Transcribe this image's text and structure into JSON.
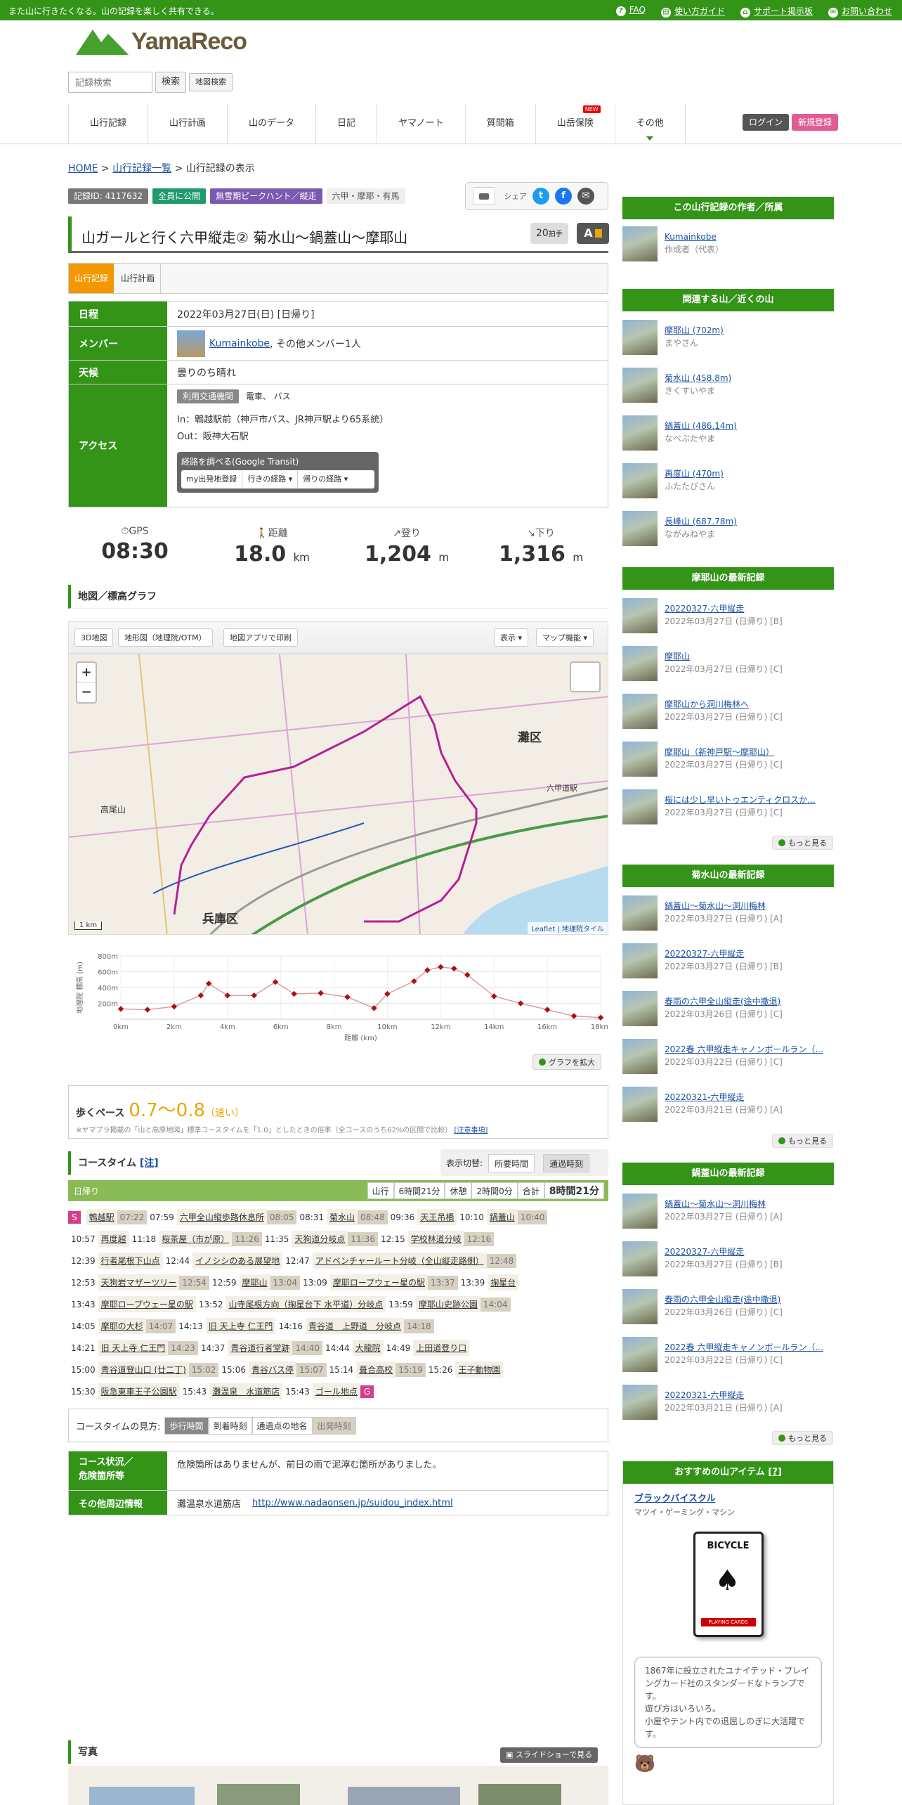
{
  "topbar": {
    "message": "また山に行きたくなる。山の記録を楽しく共有できる。",
    "links": [
      "FAQ",
      "使い方ガイド",
      "サポート掲示板",
      "お問い合わせ"
    ]
  },
  "logo": {
    "text": "YamaReco"
  },
  "search": {
    "placeholder": "記録検索",
    "button": "検索",
    "map_button": "地図検索"
  },
  "nav": [
    "山行記録",
    "山行計画",
    "山のデータ",
    "日記",
    "ヤマノート",
    "質問箱",
    "山岳保険",
    "その他"
  ],
  "nav_new": "NEW",
  "login": {
    "login": "ログイン",
    "register": "新規登録"
  },
  "breadcrumb": {
    "home": "HOME",
    "list": "山行記録一覧",
    "current": " > 山行記録の表示"
  },
  "tags": [
    "記録ID: 4117632",
    "全員に公開",
    "無雪期ピークハント／縦走",
    "六甲・摩耶・有馬"
  ],
  "share_label": "シェア",
  "title": "山ガールと行く六甲縦走② 菊水山〜鍋蓋山〜摩耶山",
  "clap": {
    "count": "20",
    "unit": "拍手"
  },
  "ai_label": "A",
  "tabs": [
    "山行記録",
    "山行計画"
  ],
  "info": {
    "date_k": "日程",
    "date_v": "2022年03月27日(日) [日帰り]",
    "member_k": "メンバー",
    "member_link": "Kumainkobe",
    "member_rest": ", その他メンバー1人",
    "weather_k": "天候",
    "weather_v": "曇りのち晴れ",
    "access_k": "アクセス",
    "access_badge": "利用交通機関",
    "access_modes": "電車、 バス",
    "access_in": "In：鵯越駅前（神戸市バス、JR神戸駅より65系統）",
    "access_out": "Out：阪神大石駅",
    "transit_title": "経路を調べる(Google Transit)",
    "transit_buttons": [
      "my出発地登録",
      "行きの経路",
      "帰りの経路"
    ]
  },
  "stats": [
    {
      "label": "GPS",
      "value": "08:30",
      "unit": ""
    },
    {
      "label": "距離",
      "value": "18.0",
      "unit": "km"
    },
    {
      "label": "登り",
      "value": "1,204",
      "unit": "m"
    },
    {
      "label": "下り",
      "value": "1,316",
      "unit": "m"
    }
  ],
  "map_section": "地図／標高グラフ",
  "map_tools": [
    "3D地図",
    "地形図（地理院/OTM）",
    "地図アプリで印刷",
    "表示",
    "マップ機能"
  ],
  "map_labels": {
    "mt": "灘区",
    "hyogo": "兵庫区",
    "takao": "高尾山",
    "scale": "1 km",
    "attrib": "Leaflet | 地理院タイル",
    "station": "六甲道駅"
  },
  "graph": {
    "ylabel": "地理院 標高 (m)",
    "xlabel": "距離 (km)"
  },
  "chart_data": {
    "type": "line",
    "title": "",
    "xlabel": "距離 (km)",
    "ylabel": "地理院 標高 (m)",
    "x_ticks": [
      "0km",
      "2km",
      "4km",
      "6km",
      "8km",
      "10km",
      "12km",
      "14km",
      "16km",
      "18km"
    ],
    "y_ticks": [
      "800m",
      "600m",
      "400m",
      "200m"
    ],
    "xlim": [
      0,
      18
    ],
    "ylim": [
      0,
      800
    ],
    "x": [
      0,
      1,
      2,
      3,
      3.3,
      4,
      5,
      5.8,
      6.5,
      7.5,
      8.5,
      9.5,
      10,
      11,
      11.5,
      12,
      12.5,
      13,
      14,
      15,
      16,
      17,
      18
    ],
    "y": [
      130,
      120,
      160,
      300,
      450,
      300,
      300,
      470,
      320,
      330,
      280,
      140,
      320,
      480,
      620,
      660,
      640,
      560,
      290,
      200,
      120,
      40,
      20
    ]
  },
  "graph_expand": "グラフを拡大",
  "pace": {
    "label": "歩くペース",
    "value": "0.7～0.8",
    "speed": "（速い）",
    "note": "※ヤマプラ掲載の「山と高原地図」標準コースタイムを「1.0」としたときの倍率（全コースのうち62%の区間で比較）",
    "note_link": "[注意事項]"
  },
  "coursetime": {
    "title": "コースタイム",
    "note": "[注]",
    "switch_label": "表示切替:",
    "switch": [
      "所要時間",
      "通過時刻"
    ],
    "day": "日帰り",
    "summary": [
      "山行",
      "6時間21分",
      "休憩",
      "2時間0分",
      "合計",
      "8時間21分"
    ]
  },
  "course_rows": [
    [
      [
        "S"
      ],
      [
        "",
        "鵯越駅",
        "07:22"
      ],
      [
        "07:59",
        "六甲全山縦歩路休息所",
        "08:05"
      ],
      [
        "08:31",
        "菊水山",
        "08:48"
      ],
      [
        "09:36",
        "天王吊橋",
        ""
      ],
      [
        "10:10",
        "鍋蓋山",
        "10:40"
      ]
    ],
    [
      [
        "10:57",
        "再度越",
        ""
      ],
      [
        "11:18",
        "桜茶屋（市が原）",
        "11:26"
      ],
      [
        "11:35",
        "天狗道分岐点",
        "11:36"
      ],
      [
        "12:15",
        "学校林道分岐",
        "12:16"
      ]
    ],
    [
      [
        "12:39",
        "行者尾根下山点",
        ""
      ],
      [
        "12:44",
        "イノシシのある展望地",
        ""
      ],
      [
        "12:47",
        "アドベンチャールート分岐（全山縦走路側）",
        "12:48"
      ]
    ],
    [
      [
        "12:53",
        "天狗岩マザーツリー",
        "12:54"
      ],
      [
        "12:59",
        "摩耶山",
        "13:04"
      ],
      [
        "13:09",
        "摩耶ロープウェー星の駅",
        "13:37"
      ],
      [
        "13:39",
        "掬星台",
        ""
      ]
    ],
    [
      [
        "13:43",
        "摩耶ロープウェー星の駅",
        ""
      ],
      [
        "13:52",
        "山寺尾根方向（掬星台下 水平道）分岐点",
        ""
      ],
      [
        "13:59",
        "摩耶山史跡公園",
        "14:04"
      ]
    ],
    [
      [
        "14:05",
        "摩耶の大杉",
        "14:07"
      ],
      [
        "14:13",
        "旧 天上寺 仁王門",
        ""
      ],
      [
        "14:16",
        "青谷道　上野道　分岐点",
        "14:18"
      ]
    ],
    [
      [
        "14:21",
        "旧 天上寺 仁王門",
        "14:23"
      ],
      [
        "14:37",
        "青谷道行者堂跡",
        "14:40"
      ],
      [
        "14:44",
        "大龍院",
        ""
      ],
      [
        "14:49",
        "上田道登り口",
        ""
      ]
    ],
    [
      [
        "15:00",
        "青谷道登山口 (廿二丁)",
        "15:02"
      ],
      [
        "15:06",
        "青谷バス停",
        "15:07"
      ],
      [
        "15:14",
        "葺合高校",
        "15:19"
      ],
      [
        "15:26",
        "王子動物園",
        ""
      ]
    ],
    [
      [
        "15:30",
        "阪急東車王子公園駅",
        ""
      ],
      [
        "15:43",
        "灘温泉　水道筋店",
        ""
      ],
      [
        "15:43",
        "ゴール地点"
      ],
      [
        "G"
      ]
    ]
  ],
  "viewhow": {
    "label": "コースタイムの見方:",
    "items": [
      "歩行時間",
      "到着時刻",
      "通過点の地名",
      "出発時刻"
    ]
  },
  "cond": {
    "k1a": "コース状況／",
    "k1b": "危険箇所等",
    "v1": "危険箇所はありませんが、前日の雨で泥濘む箇所がありました。",
    "k2": "その他周辺情報",
    "v2a": "灘温泉水道筋店",
    "v2b": "http://www.nadaonsen.jp/suidou_index.html"
  },
  "photos_section": "写真",
  "slideshow": "スライドショーで見る",
  "side": {
    "author_hd": "この山行記録の作者／所属",
    "author_name": "Kumainkobe",
    "author_role": "作成者（代表）",
    "related_hd": "関連する山／近くの山",
    "related": [
      [
        "摩耶山 (702m)",
        "まやさん"
      ],
      [
        "菊水山 (458.8m)",
        "きくすいやま"
      ],
      [
        "鍋蓋山 (486.14m)",
        "なべぶたやま"
      ],
      [
        "再度山 (470m)",
        "ふたたびさん"
      ],
      [
        "長峰山 (687.78m)",
        "ながみねやま"
      ]
    ],
    "maya_hd": "摩耶山の最新記録",
    "maya": [
      [
        "20220327-六甲縦走",
        "2022年03月27日 (日帰り) [B]"
      ],
      [
        "摩耶山",
        "2022年03月27日 (日帰り) [C]"
      ],
      [
        "摩耶山から洞川梅林へ",
        "2022年03月27日 (日帰り) [C]"
      ],
      [
        "摩耶山（新神戸駅～摩耶山）",
        "2022年03月27日 (日帰り) [C]"
      ],
      [
        "桜には少し早いトゥエンティクロスか...",
        "2022年03月27日 (日帰り) [C]"
      ]
    ],
    "kiku_hd": "菊水山の最新記録",
    "kiku": [
      [
        "鍋蓋山～菊水山～洞川梅林",
        "2022年03月27日 (日帰り) [A]"
      ],
      [
        "20220327-六甲縦走",
        "2022年03月27日 (日帰り) [B]"
      ],
      [
        "春雨の六甲全山縦走(途中撤退)",
        "2022年03月26日 (日帰り) [C]"
      ],
      [
        "2022春 六甲縦走キャノンボールラン（...",
        "2022年03月22日 (日帰り) [C]"
      ],
      [
        "20220321-六甲縦走",
        "2022年03月21日 (日帰り) [A]"
      ]
    ],
    "nabe_hd": "鍋蓋山の最新記録",
    "nabe": [
      [
        "鍋蓋山～菊水山～洞川梅林",
        "2022年03月27日 (日帰り) [A]"
      ],
      [
        "20220327-六甲縦走",
        "2022年03月27日 (日帰り) [B]"
      ],
      [
        "春雨の六甲全山縦走(途中撤退)",
        "2022年03月26日 (日帰り) [C]"
      ],
      [
        "2022春 六甲縦走キャノンボールラン（...",
        "2022年03月22日 (日帰り) [C]"
      ],
      [
        "20220321-六甲縦走",
        "2022年03月21日 (日帰り) [A]"
      ]
    ],
    "more": "もっと見る",
    "item_hd": "おすすめの山アイテム",
    "item_q": "[?]",
    "item_name": "ブラックバイスクル",
    "item_maker": "マツイ・ゲーミング・マシン",
    "item_card_top": "BICYCLE",
    "item_card_bot": "PLAYING CARDS",
    "item_desc": "1867年に設立されたユナイテッド・プレイングカード社のスタンダードなトランプです。\n遊び方はいろいろ。\n小屋やテント内での退屈しのぎに大活躍です。"
  },
  "colors": {
    "green": "#339418",
    "accent": "#e6a800",
    "pink": "#d63c8a"
  }
}
